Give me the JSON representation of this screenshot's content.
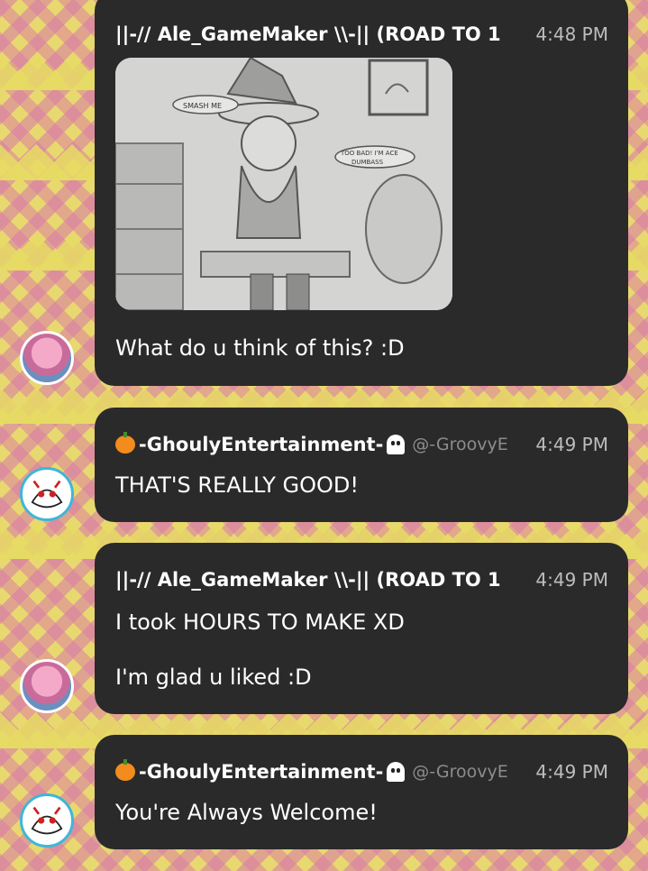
{
  "messages": [
    {
      "author": "||-// Ale_GameMaker \\\\-|| (ROAD TO 1",
      "handle": "",
      "time": "4:48 PM",
      "image": "drawing-attachment",
      "image_text": [
        "SMASH ME",
        "TOO BAD! I'M ACE DUMBASS"
      ],
      "lines": [
        "What do u think of this? :D"
      ]
    },
    {
      "author": "-GhoulyEntertainment-",
      "handle": "@-GroovyE",
      "time": "4:49 PM",
      "lines": [
        "THAT'S REALLY GOOD!"
      ]
    },
    {
      "author": "||-// Ale_GameMaker \\\\-|| (ROAD TO 1",
      "handle": "",
      "time": "4:49 PM",
      "lines": [
        "I took HOURS TO MAKE XD",
        "I'm glad u liked :D"
      ]
    },
    {
      "author": "-GhoulyEntertainment-",
      "handle": "@-GroovyE",
      "time": "4:49 PM",
      "lines": [
        "You're Always Welcome!"
      ]
    }
  ],
  "icons": {
    "ghouly_prefix": "pumpkin-icon",
    "ghouly_suffix": "ghost-icon"
  },
  "colors": {
    "bubble": "#2a2a2a",
    "timestamp": "#bdbdbd",
    "handle": "#8c8c8c",
    "avatar_ring_ghouly": "#3fb6d8"
  }
}
